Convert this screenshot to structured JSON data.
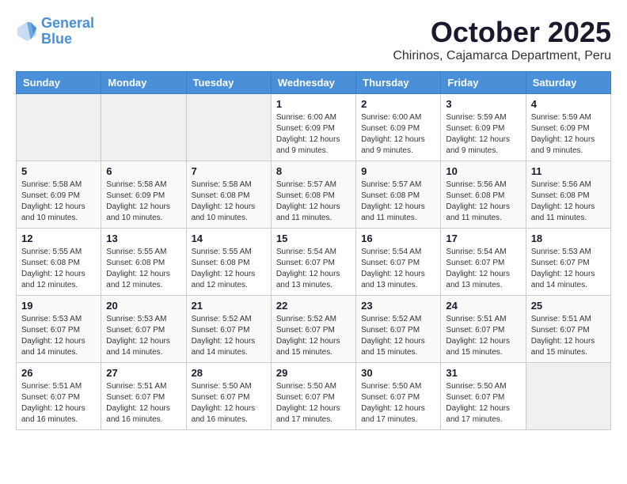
{
  "logo": {
    "line1": "General",
    "line2": "Blue"
  },
  "title": "October 2025",
  "subtitle": "Chirinos, Cajamarca Department, Peru",
  "weekdays": [
    "Sunday",
    "Monday",
    "Tuesday",
    "Wednesday",
    "Thursday",
    "Friday",
    "Saturday"
  ],
  "weeks": [
    [
      {
        "day": "",
        "info": ""
      },
      {
        "day": "",
        "info": ""
      },
      {
        "day": "",
        "info": ""
      },
      {
        "day": "1",
        "info": "Sunrise: 6:00 AM\nSunset: 6:09 PM\nDaylight: 12 hours\nand 9 minutes."
      },
      {
        "day": "2",
        "info": "Sunrise: 6:00 AM\nSunset: 6:09 PM\nDaylight: 12 hours\nand 9 minutes."
      },
      {
        "day": "3",
        "info": "Sunrise: 5:59 AM\nSunset: 6:09 PM\nDaylight: 12 hours\nand 9 minutes."
      },
      {
        "day": "4",
        "info": "Sunrise: 5:59 AM\nSunset: 6:09 PM\nDaylight: 12 hours\nand 9 minutes."
      }
    ],
    [
      {
        "day": "5",
        "info": "Sunrise: 5:58 AM\nSunset: 6:09 PM\nDaylight: 12 hours\nand 10 minutes."
      },
      {
        "day": "6",
        "info": "Sunrise: 5:58 AM\nSunset: 6:09 PM\nDaylight: 12 hours\nand 10 minutes."
      },
      {
        "day": "7",
        "info": "Sunrise: 5:58 AM\nSunset: 6:08 PM\nDaylight: 12 hours\nand 10 minutes."
      },
      {
        "day": "8",
        "info": "Sunrise: 5:57 AM\nSunset: 6:08 PM\nDaylight: 12 hours\nand 11 minutes."
      },
      {
        "day": "9",
        "info": "Sunrise: 5:57 AM\nSunset: 6:08 PM\nDaylight: 12 hours\nand 11 minutes."
      },
      {
        "day": "10",
        "info": "Sunrise: 5:56 AM\nSunset: 6:08 PM\nDaylight: 12 hours\nand 11 minutes."
      },
      {
        "day": "11",
        "info": "Sunrise: 5:56 AM\nSunset: 6:08 PM\nDaylight: 12 hours\nand 11 minutes."
      }
    ],
    [
      {
        "day": "12",
        "info": "Sunrise: 5:55 AM\nSunset: 6:08 PM\nDaylight: 12 hours\nand 12 minutes."
      },
      {
        "day": "13",
        "info": "Sunrise: 5:55 AM\nSunset: 6:08 PM\nDaylight: 12 hours\nand 12 minutes."
      },
      {
        "day": "14",
        "info": "Sunrise: 5:55 AM\nSunset: 6:08 PM\nDaylight: 12 hours\nand 12 minutes."
      },
      {
        "day": "15",
        "info": "Sunrise: 5:54 AM\nSunset: 6:07 PM\nDaylight: 12 hours\nand 13 minutes."
      },
      {
        "day": "16",
        "info": "Sunrise: 5:54 AM\nSunset: 6:07 PM\nDaylight: 12 hours\nand 13 minutes."
      },
      {
        "day": "17",
        "info": "Sunrise: 5:54 AM\nSunset: 6:07 PM\nDaylight: 12 hours\nand 13 minutes."
      },
      {
        "day": "18",
        "info": "Sunrise: 5:53 AM\nSunset: 6:07 PM\nDaylight: 12 hours\nand 14 minutes."
      }
    ],
    [
      {
        "day": "19",
        "info": "Sunrise: 5:53 AM\nSunset: 6:07 PM\nDaylight: 12 hours\nand 14 minutes."
      },
      {
        "day": "20",
        "info": "Sunrise: 5:53 AM\nSunset: 6:07 PM\nDaylight: 12 hours\nand 14 minutes."
      },
      {
        "day": "21",
        "info": "Sunrise: 5:52 AM\nSunset: 6:07 PM\nDaylight: 12 hours\nand 14 minutes."
      },
      {
        "day": "22",
        "info": "Sunrise: 5:52 AM\nSunset: 6:07 PM\nDaylight: 12 hours\nand 15 minutes."
      },
      {
        "day": "23",
        "info": "Sunrise: 5:52 AM\nSunset: 6:07 PM\nDaylight: 12 hours\nand 15 minutes."
      },
      {
        "day": "24",
        "info": "Sunrise: 5:51 AM\nSunset: 6:07 PM\nDaylight: 12 hours\nand 15 minutes."
      },
      {
        "day": "25",
        "info": "Sunrise: 5:51 AM\nSunset: 6:07 PM\nDaylight: 12 hours\nand 15 minutes."
      }
    ],
    [
      {
        "day": "26",
        "info": "Sunrise: 5:51 AM\nSunset: 6:07 PM\nDaylight: 12 hours\nand 16 minutes."
      },
      {
        "day": "27",
        "info": "Sunrise: 5:51 AM\nSunset: 6:07 PM\nDaylight: 12 hours\nand 16 minutes."
      },
      {
        "day": "28",
        "info": "Sunrise: 5:50 AM\nSunset: 6:07 PM\nDaylight: 12 hours\nand 16 minutes."
      },
      {
        "day": "29",
        "info": "Sunrise: 5:50 AM\nSunset: 6:07 PM\nDaylight: 12 hours\nand 17 minutes."
      },
      {
        "day": "30",
        "info": "Sunrise: 5:50 AM\nSunset: 6:07 PM\nDaylight: 12 hours\nand 17 minutes."
      },
      {
        "day": "31",
        "info": "Sunrise: 5:50 AM\nSunset: 6:07 PM\nDaylight: 12 hours\nand 17 minutes."
      },
      {
        "day": "",
        "info": ""
      }
    ]
  ]
}
